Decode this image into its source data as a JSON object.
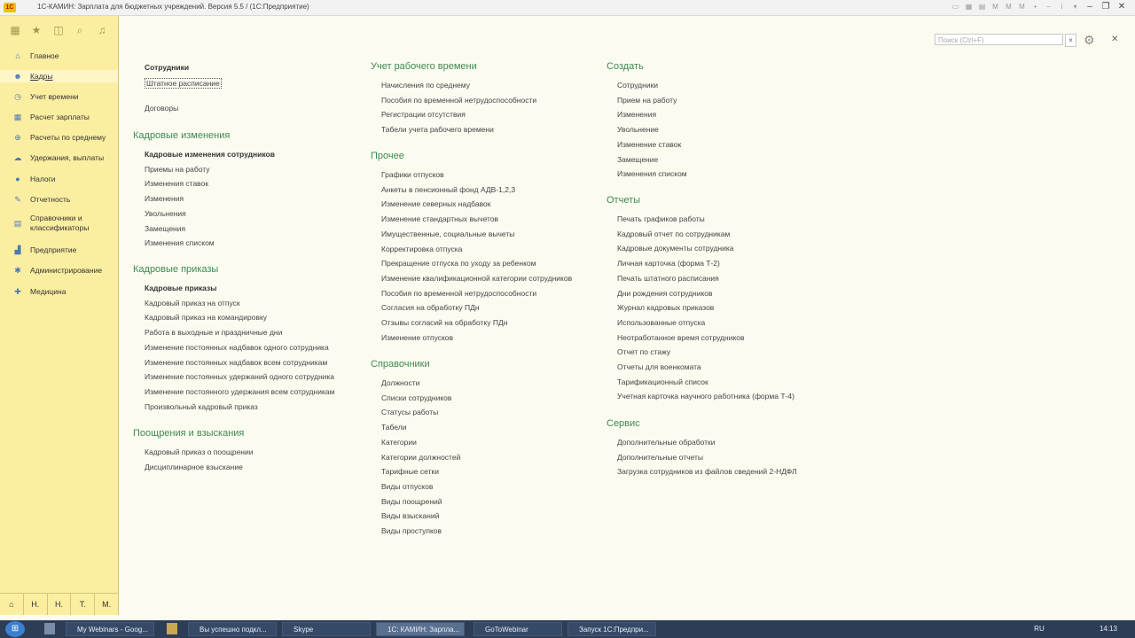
{
  "window": {
    "title": "1С-КАМИН: Зарплата для бюджетных учреждений. Версия 5.5 /   (1С:Предприятие)"
  },
  "sidebar": {
    "items": [
      {
        "label": "Главное",
        "icon": "home-icon",
        "glyph": "⌂",
        "color": "#4a7ab0"
      },
      {
        "label": "Кадры",
        "icon": "people-icon",
        "glyph": "☻",
        "color": "#4a7ab0"
      },
      {
        "label": "Учет времени",
        "icon": "clock-icon",
        "glyph": "◷",
        "color": "#4a7ab0"
      },
      {
        "label": "Расчет зарплаты",
        "icon": "calc-icon",
        "glyph": "▦",
        "color": "#4a7ab0"
      },
      {
        "label": "Расчеты по среднему",
        "icon": "average-icon",
        "glyph": "⊕",
        "color": "#4a7ab0"
      },
      {
        "label": "Удержания, выплаты",
        "icon": "payment-icon",
        "glyph": "☁",
        "color": "#4a7ab0"
      },
      {
        "label": "Налоги",
        "icon": "tax-icon",
        "glyph": "●",
        "color": "#4a7ab0"
      },
      {
        "label": "Отчетность",
        "icon": "report-icon",
        "glyph": "✎",
        "color": "#4a7ab0"
      },
      {
        "label": "Справочники и классификаторы",
        "icon": "directory-icon",
        "glyph": "▤",
        "color": "#4a7ab0"
      },
      {
        "label": "Предприятие",
        "icon": "enterprise-icon",
        "glyph": "▟",
        "color": "#4a7ab0"
      },
      {
        "label": "Администрирование",
        "icon": "admin-icon",
        "glyph": "✱",
        "color": "#4a7ab0"
      },
      {
        "label": "Медицина",
        "icon": "medicine-icon",
        "glyph": "✚",
        "color": "#4a7ab0"
      }
    ],
    "active_index": 1,
    "bottom_tabs": [
      "Н.",
      "Н.",
      "Т.",
      "М."
    ]
  },
  "search": {
    "placeholder": "Поиск (Ctrl+F)"
  },
  "columns": {
    "col1": {
      "top_links": [
        {
          "label": "Сотрудники",
          "bold": true
        },
        {
          "label": "Штатное расписание",
          "boxed": true
        },
        {
          "label": "Договоры"
        }
      ],
      "sections": [
        {
          "title": "Кадровые изменения",
          "links": [
            {
              "label": "Кадровые изменения сотрудников",
              "bold": true
            },
            {
              "label": "Приемы на работу"
            },
            {
              "label": "Изменения ставок"
            },
            {
              "label": "Изменения"
            },
            {
              "label": "Увольнения"
            },
            {
              "label": "Замещения"
            },
            {
              "label": "Изменения списком"
            }
          ]
        },
        {
          "title": "Кадровые приказы",
          "links": [
            {
              "label": "Кадровые приказы",
              "bold": true
            },
            {
              "label": "Кадровый приказ на отпуск"
            },
            {
              "label": "Кадровый приказ на командировку"
            },
            {
              "label": "Работа в выходные и праздничные дни"
            },
            {
              "label": "Изменение постоянных надбавок одного сотрудника"
            },
            {
              "label": "Изменение постоянных надбавок всем сотрудникам"
            },
            {
              "label": "Изменение постоянных удержаний одного сотрудника"
            },
            {
              "label": "Изменение постоянного удержания всем сотрудникам"
            },
            {
              "label": "Произвольный кадровый приказ"
            }
          ]
        },
        {
          "title": "Поощрения и взыскания",
          "links": [
            {
              "label": "Кадровый приказ о поощрении"
            },
            {
              "label": "Дисциплинарное взыскание"
            }
          ]
        }
      ]
    },
    "col2": {
      "sections": [
        {
          "title": "Учет рабочего времени",
          "links": [
            {
              "label": "Начисления по среднему"
            },
            {
              "label": "Пособия по временной нетрудоспособности"
            },
            {
              "label": "Регистрации отсутствия"
            },
            {
              "label": "Табели учета рабочего времени"
            }
          ]
        },
        {
          "title": "Прочее",
          "links": [
            {
              "label": "Графики отпусков"
            },
            {
              "label": "Анкеты в пенсионный фонд АДВ-1,2,3"
            },
            {
              "label": "Изменение северных надбавок"
            },
            {
              "label": "Изменение стандартных вычетов"
            },
            {
              "label": "Имущественные, социальные вычеты"
            },
            {
              "label": "Корректировка отпуска"
            },
            {
              "label": "Прекращение отпуска по уходу за ребенком"
            },
            {
              "label": "Изменение квалификационной категории сотрудников"
            },
            {
              "label": "Пособия по временной нетрудоспособности"
            },
            {
              "label": "Согласия на обработку ПДн"
            },
            {
              "label": "Отзывы согласий на обработку ПДн"
            },
            {
              "label": "Изменение отпусков"
            }
          ]
        },
        {
          "title": "Справочники",
          "links": [
            {
              "label": "Должности"
            },
            {
              "label": "Списки сотрудников"
            },
            {
              "label": "Статусы работы"
            },
            {
              "label": "Табели"
            },
            {
              "label": "Категории"
            },
            {
              "label": "Категории должностей"
            },
            {
              "label": "Тарифные сетки"
            },
            {
              "label": "Виды отпусков"
            },
            {
              "label": "Виды поощрений"
            },
            {
              "label": "Виды взысканий"
            },
            {
              "label": "Виды проступков"
            }
          ]
        }
      ]
    },
    "col3": {
      "sections": [
        {
          "title": "Создать",
          "links": [
            {
              "label": "Сотрудники"
            },
            {
              "label": "Прием на работу"
            },
            {
              "label": "Изменения"
            },
            {
              "label": "Увольнение"
            },
            {
              "label": "Изменение ставок"
            },
            {
              "label": "Замещение"
            },
            {
              "label": "Изменения списком"
            }
          ]
        },
        {
          "title": "Отчеты",
          "links": [
            {
              "label": "Печать графиков работы"
            },
            {
              "label": "Кадровый отчет по сотрудникам"
            },
            {
              "label": "Кадровые документы сотрудника"
            },
            {
              "label": "Личная карточка (форма Т-2)"
            },
            {
              "label": "Печать штатного расписания"
            },
            {
              "label": "Дни рождения сотрудников"
            },
            {
              "label": "Журнал кадровых приказов"
            },
            {
              "label": "Использованные отпуска"
            },
            {
              "label": "Неотработанное время сотрудников"
            },
            {
              "label": "Отчет по стажу"
            },
            {
              "label": "Отчеты для военкомата"
            },
            {
              "label": "Тарификационный список"
            },
            {
              "label": "Учетная карточка научного работника (форма Т-4)"
            }
          ]
        },
        {
          "title": "Сервис",
          "links": [
            {
              "label": "Дополнительные обработки"
            },
            {
              "label": "Дополнительные отчеты"
            },
            {
              "label": "Загрузка сотрудников из файлов сведений 2-НДФЛ"
            }
          ]
        }
      ]
    }
  },
  "taskbar": {
    "apps": [
      {
        "label": "My Webinars - Goog..."
      },
      {
        "label": "Вы успешно подкл..."
      },
      {
        "label": "Skype"
      },
      {
        "label": "1С: КАМИН: Зарпла...",
        "active": true
      },
      {
        "label": "GoToWebinar"
      },
      {
        "label": "Запуск 1С:Предпри..."
      }
    ],
    "lang": "RU",
    "time": "14:13"
  }
}
